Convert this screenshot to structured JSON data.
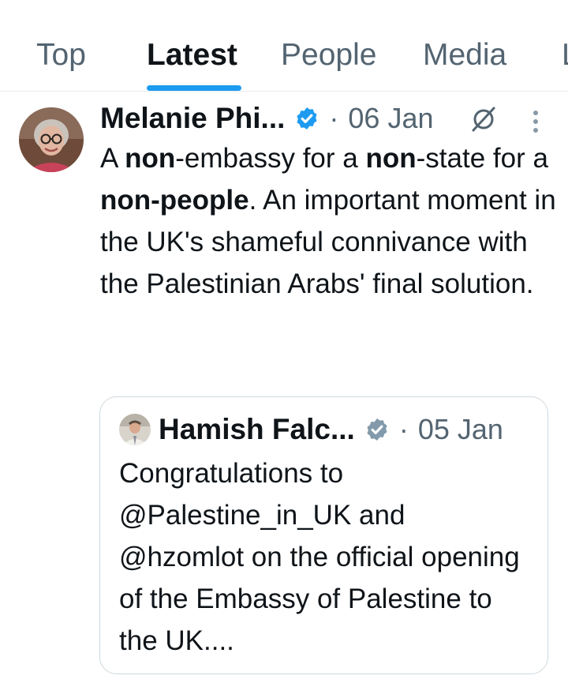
{
  "tabs": [
    {
      "label": "Top",
      "active": false
    },
    {
      "label": "Latest",
      "active": true
    },
    {
      "label": "People",
      "active": false
    },
    {
      "label": "Media",
      "active": false
    },
    {
      "label": "L",
      "active": false
    }
  ],
  "tweet": {
    "author": "Melanie Phi...",
    "separator": "·",
    "date": "06 Jan",
    "text_parts": [
      "A ",
      "non",
      "-embassy for a ",
      "non",
      "-state for a ",
      "non-people",
      ". An important moment in the UK's shameful connivance with the Palestinian Arabs' final solution."
    ]
  },
  "quoted_tweet": {
    "author": "Hamish Falc...",
    "separator": "·",
    "date": "05 Jan",
    "text": "Congratulations to @Palestine_in_UK and @hzomlot on the official opening of the Embassy of Palestine to the UK...."
  },
  "colors": {
    "accent": "#1d9bf0",
    "secondary_text": "#536471",
    "border": "#cfd9de",
    "verified_badge": "#1d9bf0",
    "quoted_verified_badge": "#829aab"
  },
  "icons": {
    "verified": "verified-badge-icon",
    "block": "muted-circle-slash-icon",
    "more": "more-vertical-icon"
  }
}
